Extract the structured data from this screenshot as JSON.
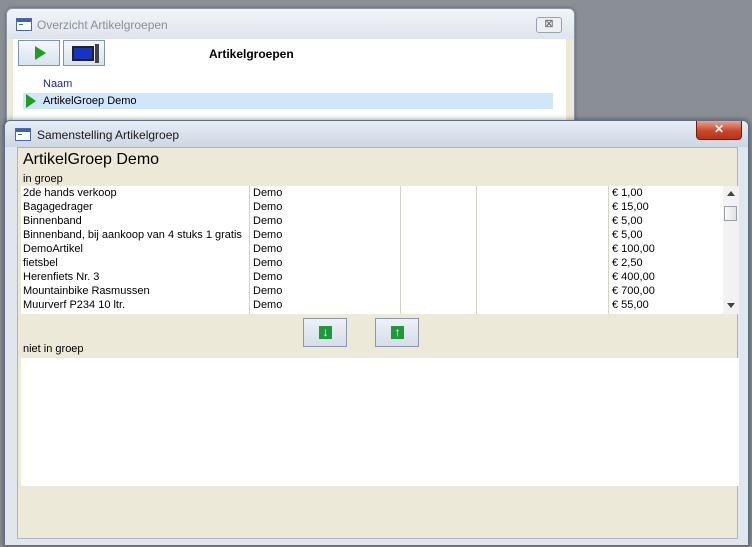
{
  "back_window": {
    "title": "Overzicht Artikelgroepen",
    "close_label": "⊠",
    "heading": "Artikelgroepen",
    "column_header": "Naam",
    "rows": [
      "ArtikelGroep Demo"
    ]
  },
  "front_window": {
    "title": "Samenstelling Artikelgroep",
    "close_label": "✕",
    "group_title": "ArtikelGroep Demo",
    "in_group_label": "in groep",
    "not_in_group_label": "niet in groep",
    "move_down_label": "↓",
    "move_up_label": "↑",
    "items": [
      {
        "name": "2de hands verkoop",
        "group": "Demo",
        "price": "€ 1,00"
      },
      {
        "name": "Bagagedrager",
        "group": "Demo",
        "price": "€ 15,00"
      },
      {
        "name": "Binnenband",
        "group": "Demo",
        "price": "€ 5,00"
      },
      {
        "name": "Binnenband, bij aankoop van 4 stuks 1 gratis",
        "group": "Demo",
        "price": "€ 5,00"
      },
      {
        "name": "DemoArtikel",
        "group": "Demo",
        "price": "€ 100,00"
      },
      {
        "name": "fietsbel",
        "group": "Demo",
        "price": "€ 2,50"
      },
      {
        "name": "Herenfiets Nr. 3",
        "group": "Demo",
        "price": "€ 400,00"
      },
      {
        "name": "Mountainbike Rasmussen",
        "group": "Demo",
        "price": "€ 700,00"
      },
      {
        "name": "Muurverf P234 10 ltr.",
        "group": "Demo",
        "price": "€ 55,00"
      }
    ]
  },
  "icons": {
    "window": "form-window-icon",
    "run": "play-icon",
    "design": "screen-icon",
    "record_selector": "selected-row-arrow-icon"
  },
  "colors": {
    "selection": "#cfe6fb",
    "accent_green": "#1e9e1e",
    "close_red": "#c9462c"
  }
}
